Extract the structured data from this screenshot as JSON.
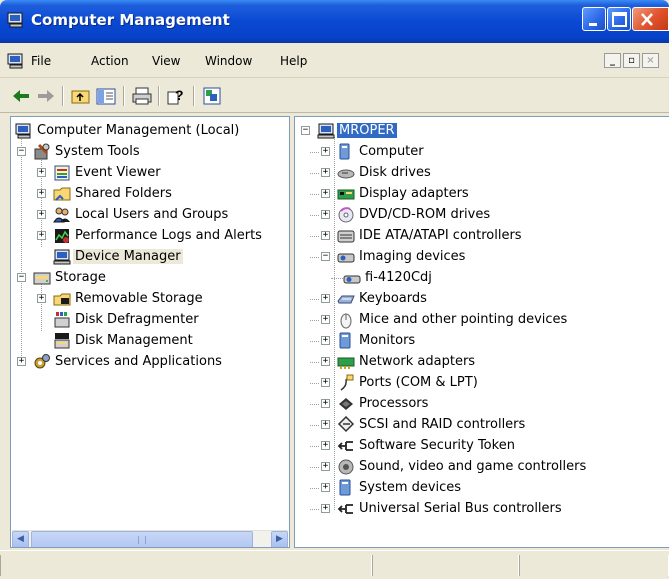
{
  "window": {
    "title": "Computer Management",
    "controls": [
      "minimize",
      "maximize",
      "close"
    ]
  },
  "menubar": {
    "items": [
      "File",
      "Action",
      "View",
      "Window",
      "Help"
    ]
  },
  "toolbar": {
    "buttons": [
      "back-icon",
      "forward-icon",
      "up-one-level-icon",
      "show-hide-console-tree-icon",
      "print-icon",
      "help-icon",
      "properties-icon"
    ]
  },
  "left_tree": {
    "root": "Computer Management (Local)",
    "system_tools": "System Tools",
    "event_viewer": "Event Viewer",
    "shared_folders": "Shared Folders",
    "local_users": "Local Users and Groups",
    "performance_logs": "Performance Logs and Alerts",
    "device_manager": "Device Manager",
    "storage": "Storage",
    "removable_storage": "Removable Storage",
    "disk_defragmenter": "Disk Defragmenter",
    "disk_management": "Disk Management",
    "services_apps": "Services and Applications"
  },
  "right_tree": {
    "root": "MROPER",
    "items": [
      "Computer",
      "Disk drives",
      "Display adapters",
      "DVD/CD-ROM drives",
      "IDE ATA/ATAPI controllers",
      "Imaging devices",
      "fi-4120Cdj",
      "Keyboards",
      "Mice and other pointing devices",
      "Monitors",
      "Network adapters",
      "Ports (COM & LPT)",
      "Processors",
      "SCSI and RAID controllers",
      "Software Security Token",
      "Sound, video and game controllers",
      "System devices",
      "Universal Serial Bus controllers"
    ]
  },
  "colors": {
    "titlebar": "#0a49d3",
    "selection": "#316ac5",
    "chrome": "#ece9d8"
  }
}
